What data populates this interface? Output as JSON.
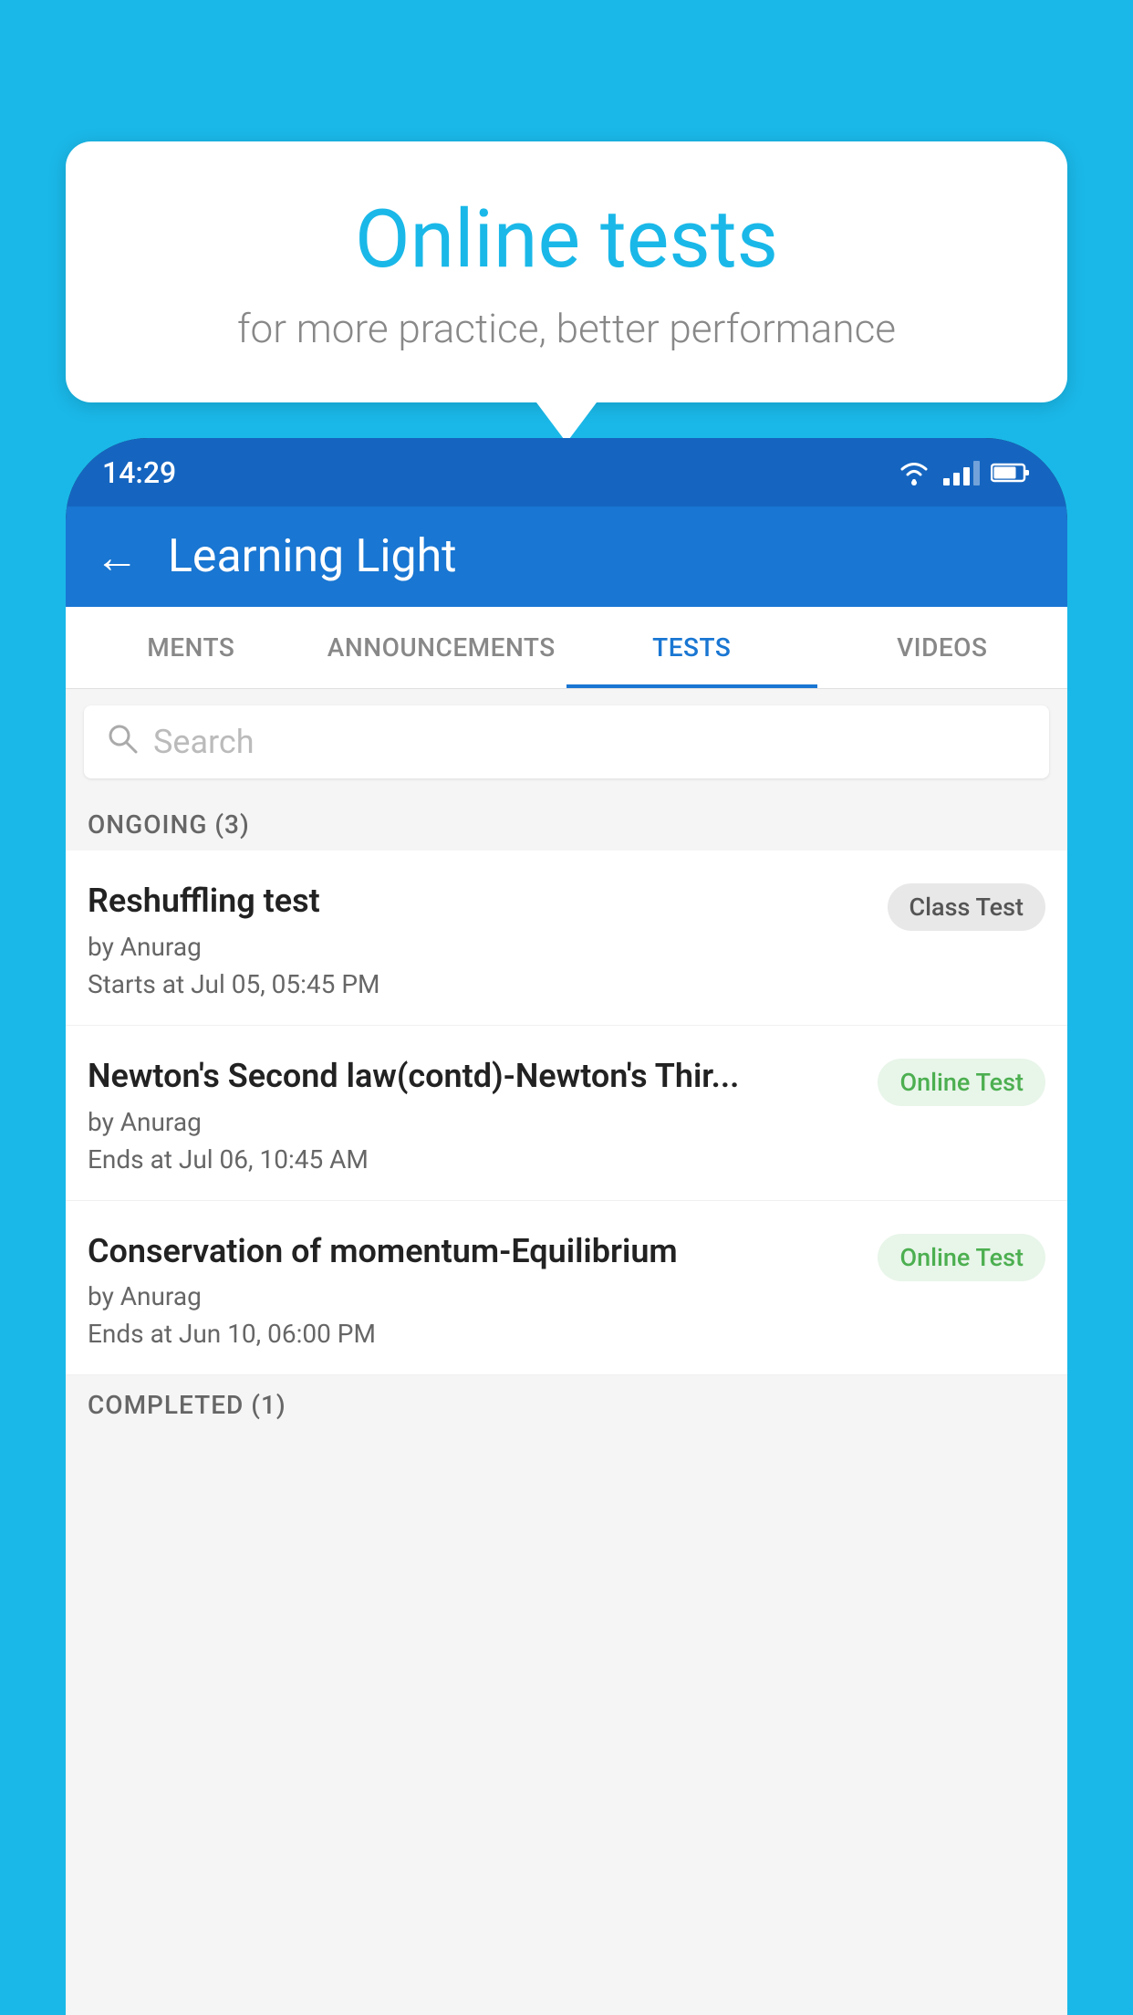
{
  "background": {
    "color": "#1ab8e8"
  },
  "speech_bubble": {
    "title": "Online tests",
    "subtitle": "for more practice, better performance"
  },
  "phone": {
    "status_bar": {
      "time": "14:29"
    },
    "app_bar": {
      "back_label": "←",
      "title": "Learning Light"
    },
    "tabs": [
      {
        "label": "MENTS",
        "active": false
      },
      {
        "label": "ANNOUNCEMENTS",
        "active": false
      },
      {
        "label": "TESTS",
        "active": true
      },
      {
        "label": "VIDEOS",
        "active": false
      }
    ],
    "search": {
      "placeholder": "Search"
    },
    "sections": [
      {
        "header": "ONGOING (3)",
        "items": [
          {
            "name": "Reshuffling test",
            "author": "by Anurag",
            "time": "Starts at  Jul 05, 05:45 PM",
            "badge": "Class Test",
            "badge_type": "class"
          },
          {
            "name": "Newton's Second law(contd)-Newton's Thir...",
            "author": "by Anurag",
            "time": "Ends at  Jul 06, 10:45 AM",
            "badge": "Online Test",
            "badge_type": "online"
          },
          {
            "name": "Conservation of momentum-Equilibrium",
            "author": "by Anurag",
            "time": "Ends at  Jun 10, 06:00 PM",
            "badge": "Online Test",
            "badge_type": "online"
          }
        ]
      }
    ],
    "completed_header": "COMPLETED (1)"
  }
}
